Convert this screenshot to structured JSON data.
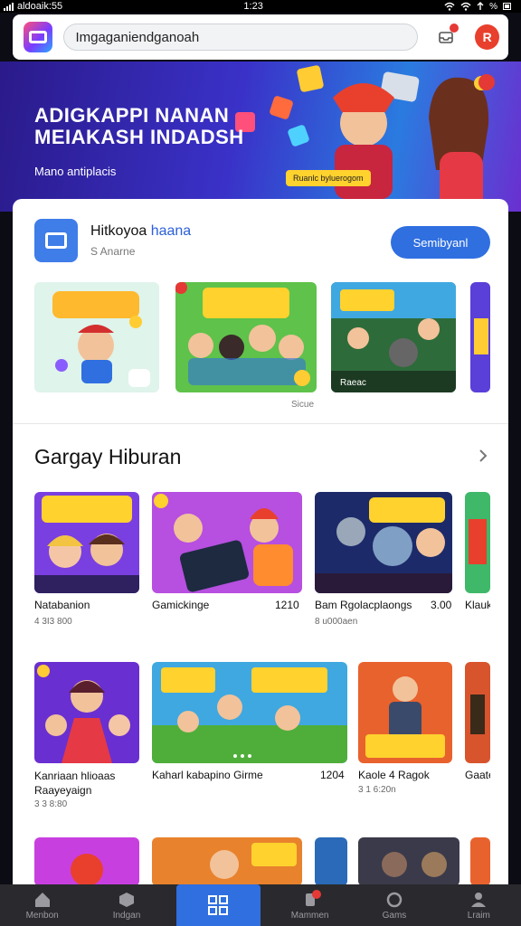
{
  "status_bar": {
    "carrier": "aldoaik:55",
    "time": "1:23",
    "battery": "%"
  },
  "header": {
    "search_value": "Imgaganiendganoah",
    "avatar_initial": "R"
  },
  "hero": {
    "title": "ADIGKAPPI NANAN MEIAKASH INDADSH",
    "subtitle": "Mano antiplacis",
    "chip_label": "Ruanlc byluerogom"
  },
  "featured_app": {
    "name_prefix": "Hitkoyoa ",
    "name_accent": "haana",
    "meta": "S Anarne",
    "button_label": "Semibyanl",
    "screenshots": [
      {
        "label": ""
      },
      {
        "label": "Sicue"
      },
      {
        "label": "Raeac"
      }
    ]
  },
  "section": {
    "title": "Gargay Hiburan"
  },
  "games": [
    {
      "name": "Natabanion",
      "meta": "4 3I3 800",
      "value": ""
    },
    {
      "name": "Gamickinge",
      "meta": "",
      "value": "1210"
    },
    {
      "name": "Bam Rgolacplaongs",
      "meta": "8 u000aen",
      "value": "3.00"
    },
    {
      "name": "Klauk",
      "meta": "",
      "value": ""
    },
    {
      "name": "Kanriaan hlioaas Raayeyaign",
      "meta": "3 3 8:80",
      "value": ""
    },
    {
      "name": "Kaharl kabapino Girme",
      "meta": "",
      "value": "1204"
    },
    {
      "name": "Kaole 4 Ragok",
      "meta": "3 1 6:20n",
      "value": ""
    },
    {
      "name": "Gaate",
      "meta": "",
      "value": ""
    }
  ],
  "bottom_nav": [
    {
      "label": "Menbon",
      "icon": "home-icon"
    },
    {
      "label": "Indgan",
      "icon": "box-icon"
    },
    {
      "label": "",
      "icon": "apps-icon"
    },
    {
      "label": "Mammen",
      "icon": "gamepad-icon"
    },
    {
      "label": "Gams",
      "icon": "controller-icon"
    },
    {
      "label": "Lraim",
      "icon": "person-icon"
    }
  ],
  "colors": {
    "accent": "#2f6fe0",
    "badge": "#e53935",
    "nav_bg": "#2a2a2e"
  }
}
